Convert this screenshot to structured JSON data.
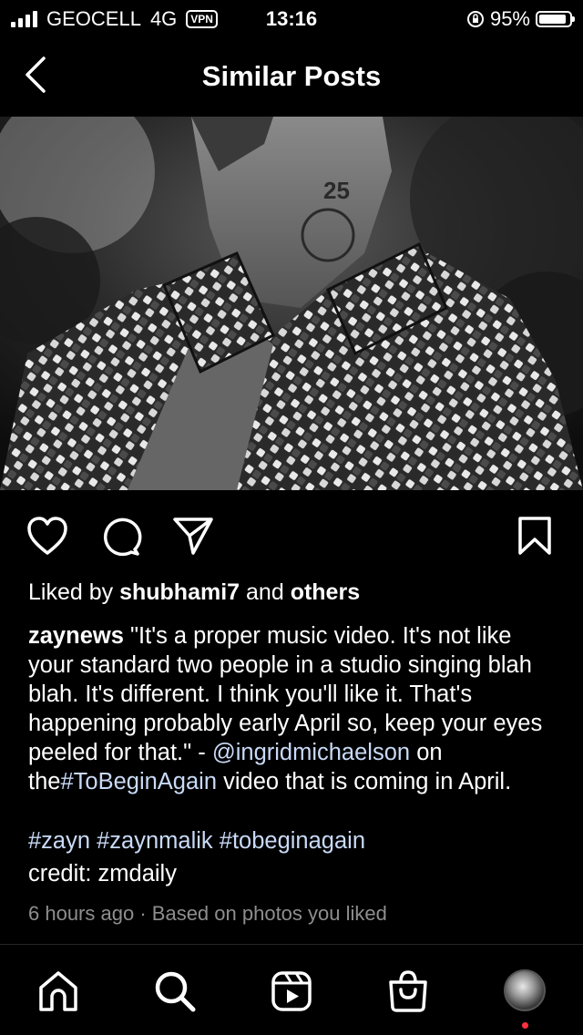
{
  "status_bar": {
    "carrier": "GEOCELL",
    "network": "4G",
    "vpn": "VPN",
    "time": "13:16",
    "battery": "95%",
    "battery_level": 0.95
  },
  "header": {
    "title": "Similar Posts"
  },
  "post": {
    "liked_by_prefix": "Liked by",
    "liked_by_user": "shubhami7",
    "liked_by_and": "and",
    "liked_by_others": "others",
    "username": "zaynews",
    "caption_text": "\"It's a proper music video. It's not like your standard two people in a studio singing blah blah. It's different. I think you'll like it. That's happening probably early April so, keep your eyes peeled for that.\" -",
    "mention": "@ingridmichaelson",
    "caption_mid": "on the",
    "hashtag_inline": "#ToBeginAgain",
    "caption_end": "video that is coming in April.",
    "hashtags": "#zayn #zaynmalik #tobeginagain",
    "credit": "credit: zmdaily",
    "time_ago": "6 hours ago",
    "separator": "·",
    "reason": "Based on photos you liked"
  },
  "icons": {
    "back": "chevron-left-icon",
    "like": "heart-icon",
    "comment": "comment-icon",
    "share": "send-icon",
    "save": "bookmark-icon",
    "home": "home-icon",
    "search": "search-icon",
    "reels": "reels-icon",
    "shop": "shop-bag-icon",
    "profile": "profile-avatar"
  },
  "colors": {
    "background": "#000000",
    "link": "#c9daf7",
    "meta": "#8e8e8e",
    "notification_dot": "#ff3040"
  }
}
